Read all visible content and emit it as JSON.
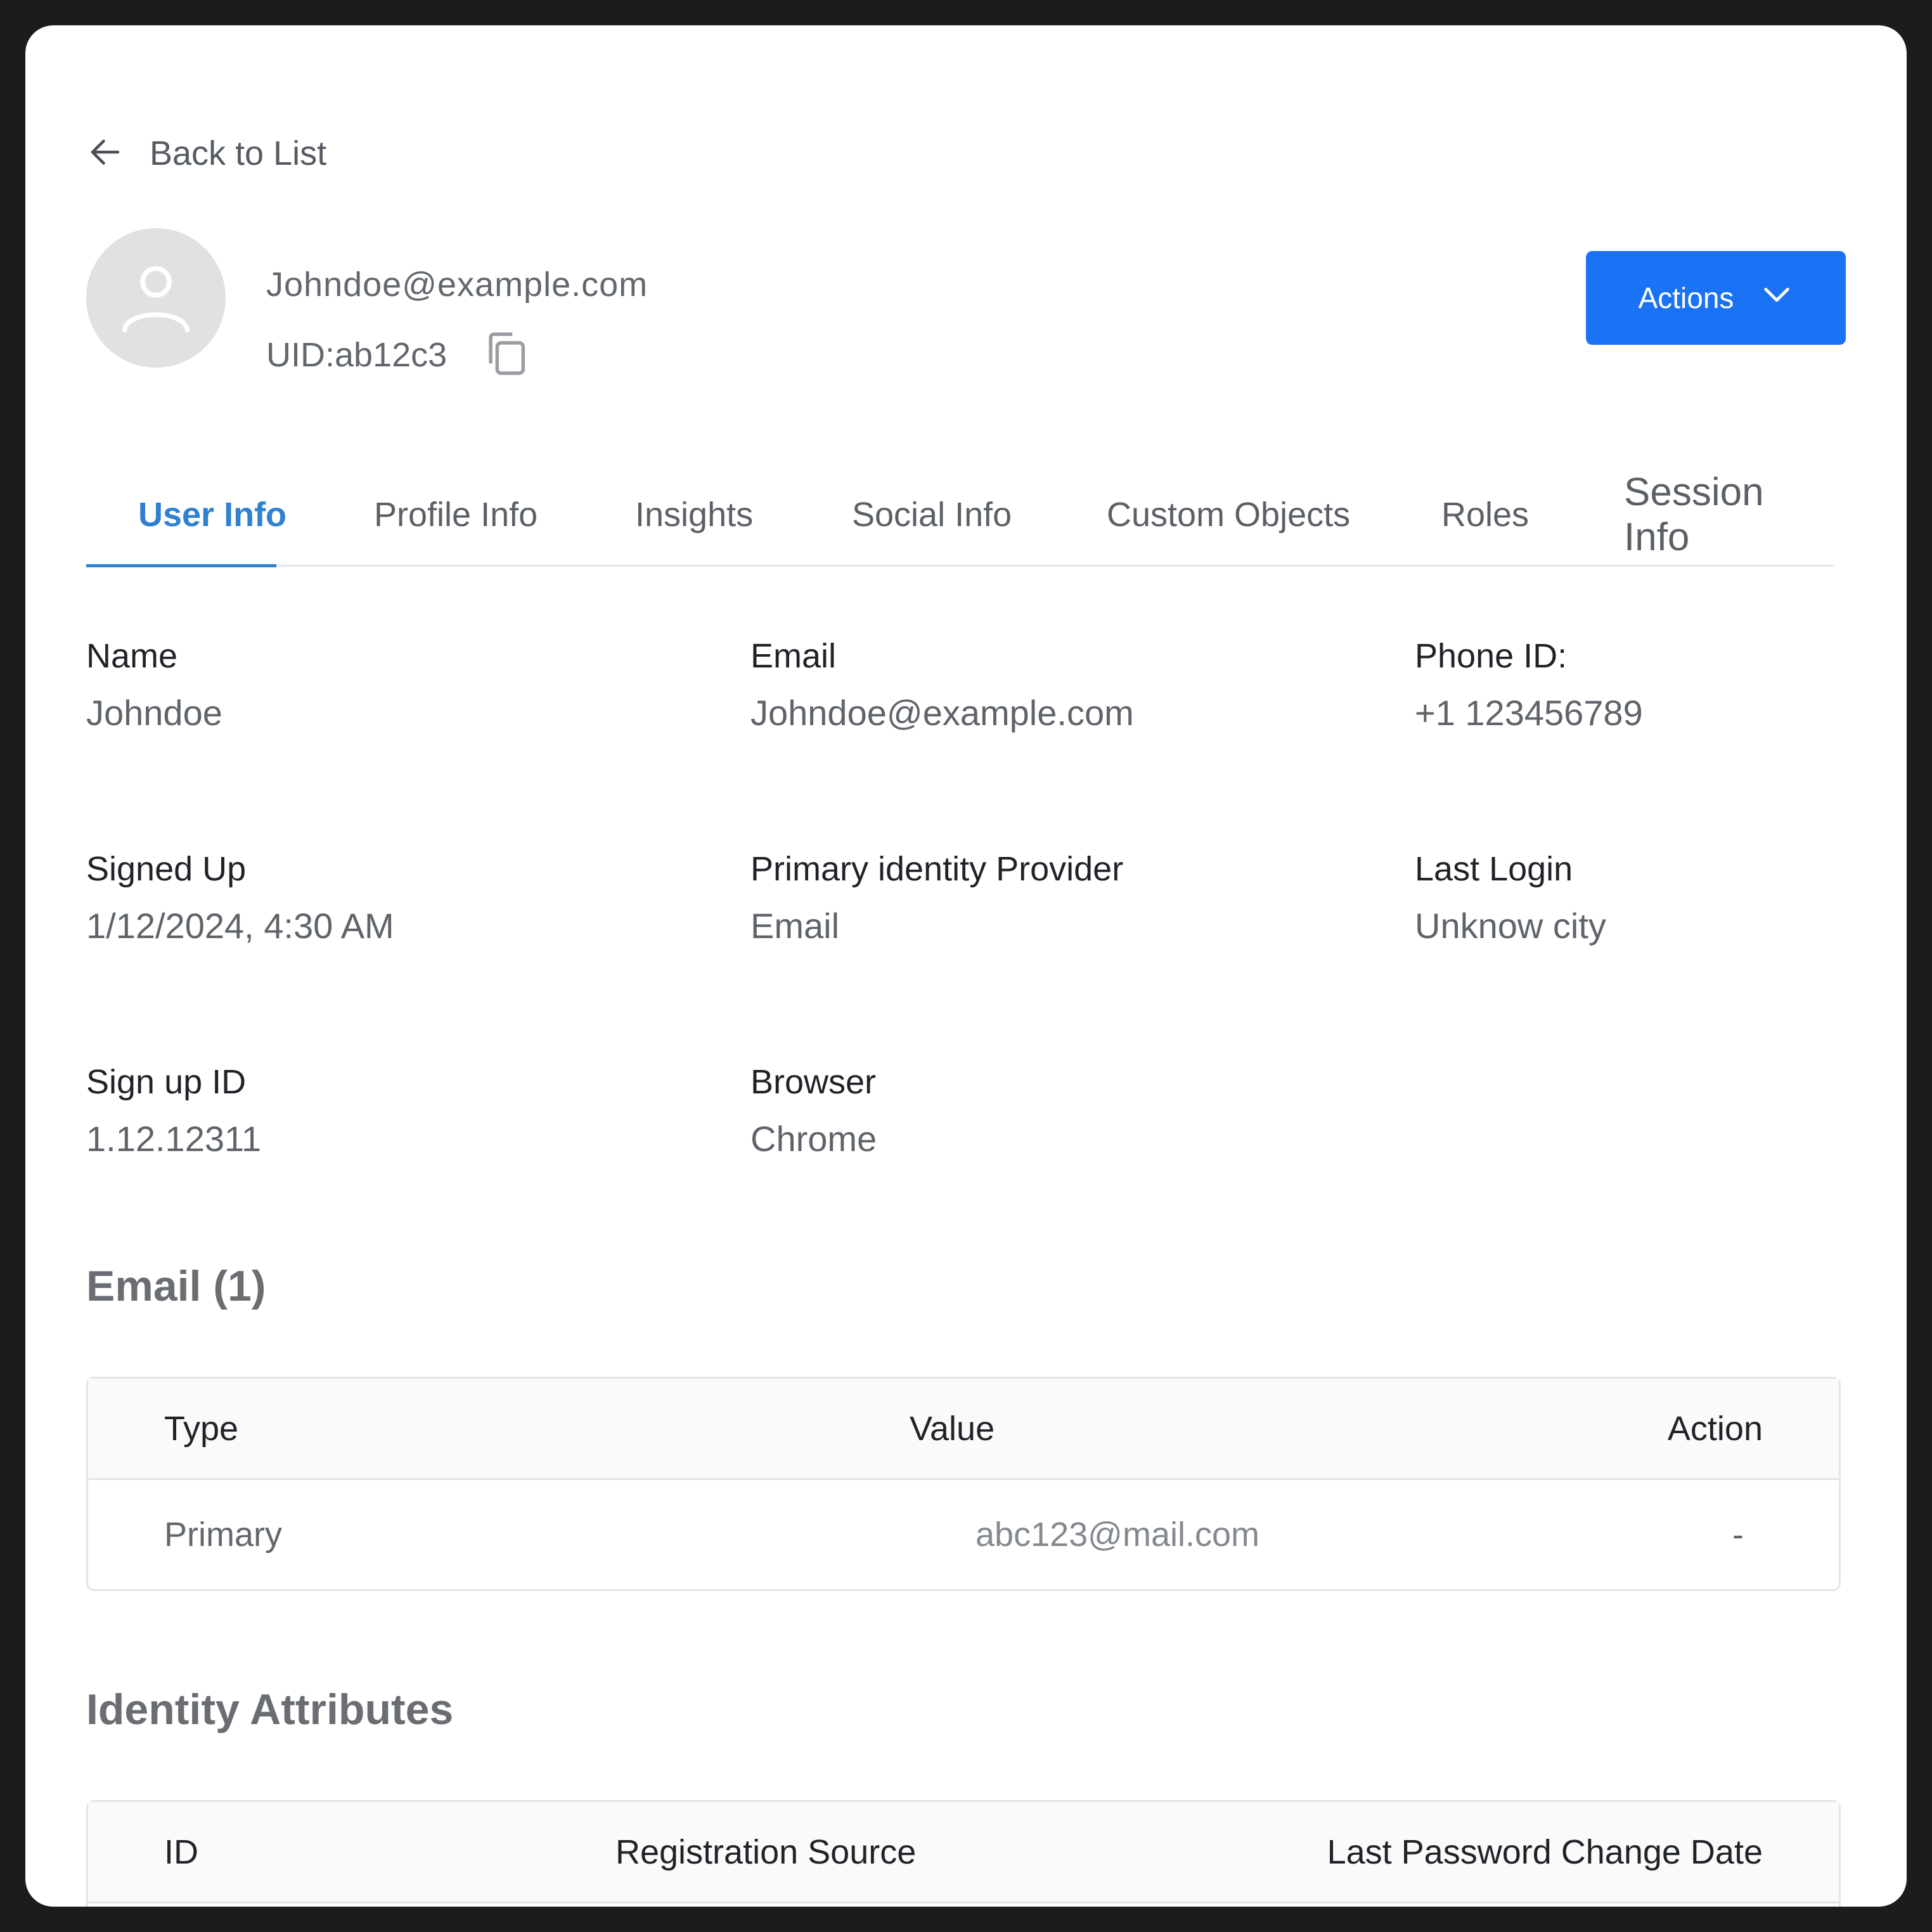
{
  "back": {
    "label": "Back to List"
  },
  "user": {
    "email": "Johndoe@example.com",
    "uid": "UID:ab12c3"
  },
  "actions": {
    "label": "Actions"
  },
  "tabs": [
    {
      "label": "User Info",
      "active": true
    },
    {
      "label": "Profile Info"
    },
    {
      "label": "Insights"
    },
    {
      "label": "Social Info"
    },
    {
      "label": "Custom Objects"
    },
    {
      "label": "Roles"
    },
    {
      "label": "Session Info"
    }
  ],
  "info": {
    "name": {
      "label": "Name",
      "value": "Johndoe"
    },
    "email": {
      "label": "Email",
      "value": "Johndoe@example.com"
    },
    "phone": {
      "label": "Phone ID:",
      "value": "+1 123456789"
    },
    "signed_up": {
      "label": "Signed Up",
      "value": "1/12/2024, 4:30 AM"
    },
    "provider": {
      "label": "Primary identity Provider",
      "value": "Email"
    },
    "last_login": {
      "label": "Last Login",
      "value": "Unknow city"
    },
    "signup_id": {
      "label": "Sign up ID",
      "value": "1.12.12311"
    },
    "browser": {
      "label": "Browser",
      "value": "Chrome"
    }
  },
  "email_section": {
    "title": "Email (1)",
    "columns": [
      "Type",
      "Value",
      "Action"
    ],
    "rows": [
      {
        "type": "Primary",
        "value": "abc123@mail.com",
        "action": "-"
      }
    ]
  },
  "identity_section": {
    "title": "Identity Attributes",
    "columns": [
      "ID",
      "Registration Source",
      "Last Password Change Date"
    ]
  },
  "colors": {
    "accent": "#1a73f5",
    "tab_active": "#2f80d1"
  },
  "icons": [
    "arrow-left-icon",
    "user-icon",
    "copy-icon",
    "chevron-down-icon"
  ]
}
